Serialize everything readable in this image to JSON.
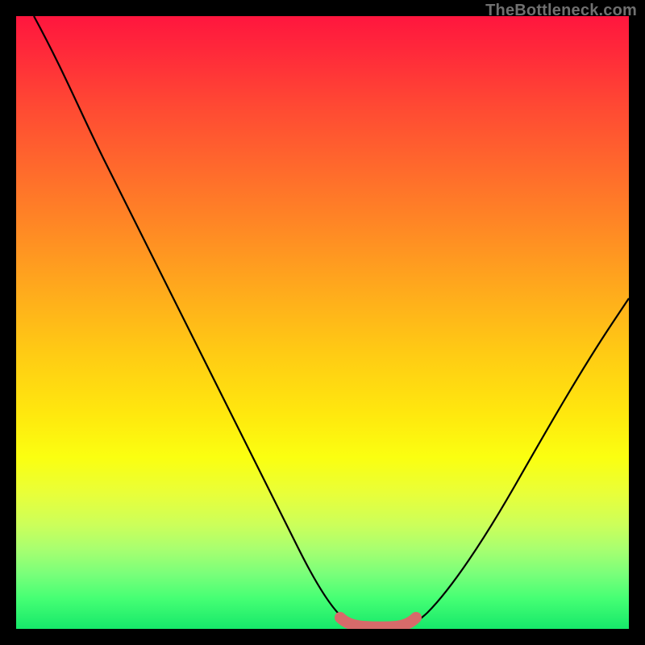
{
  "watermark": "TheBottleneck.com",
  "colors": {
    "background": "#000000",
    "curve": "#000000",
    "highlight": "#d76a6a"
  },
  "chart_data": {
    "type": "line",
    "title": "",
    "xlabel": "",
    "ylabel": "",
    "x_range_pct": [
      0,
      100
    ],
    "y_range_pct": [
      0,
      100
    ],
    "series": [
      {
        "name": "bottleneck-curve",
        "x_pct": [
          3,
          8,
          14,
          20,
          26,
          32,
          38,
          44,
          48,
          51,
          53,
          55,
          61,
          63,
          66,
          72,
          80,
          88,
          96,
          100
        ],
        "y_pct": [
          100,
          90,
          80,
          70,
          60,
          50,
          40,
          28,
          16,
          7,
          2,
          0,
          0,
          0.5,
          5,
          15,
          28,
          40,
          50,
          56
        ]
      },
      {
        "name": "optimal-zone",
        "x_pct": [
          53,
          55,
          57,
          59,
          61,
          63
        ],
        "y_pct": [
          1.8,
          0.5,
          0,
          0,
          0.5,
          1.8
        ]
      }
    ],
    "note": "y_pct = 0 is the bottom (green) edge; y_pct = 100 is the top (red) edge. x_pct is horizontal position across the plot."
  }
}
